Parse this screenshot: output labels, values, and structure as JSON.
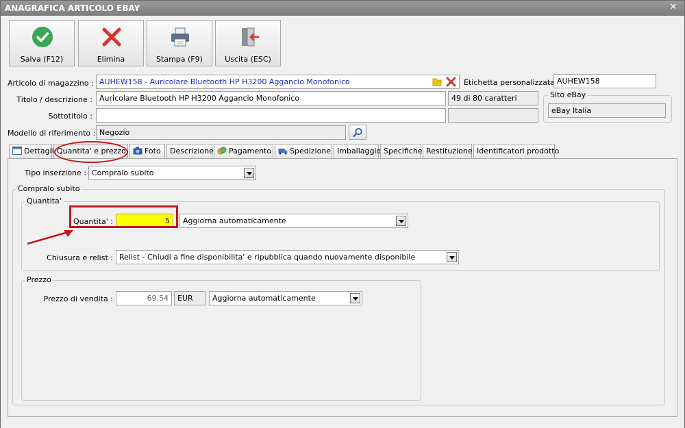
{
  "window": {
    "title": "ANAGRAFICA ARTICOLO EBAY",
    "close_glyph": "✕"
  },
  "toolbar": {
    "save_label": "Salva (F12)",
    "delete_label": "Elimina",
    "print_label": "Stampa (F9)",
    "exit_label": "Uscita (ESC)"
  },
  "form": {
    "articolo_label": "Articolo di magazzino :",
    "articolo_value": "AUHEW158 - Auricolare Bluetooth HP H3200 Aggancio Monofonico",
    "etichetta_label": "Etichetta personalizzata :",
    "etichetta_value": "AUHEW158",
    "titolo_label": "Titolo / descrizione :",
    "titolo_value": "Auricolare Bluetooth HP H3200 Aggancio Monofonico",
    "char_count": "49 di 80 caratteri",
    "sottotitolo_label": "Sottotitolo :",
    "sottotitolo_value": "",
    "modello_label": "Modello di riferimento :",
    "modello_value": "Negozio",
    "sito_group_title": "Sito eBay",
    "sito_value": "eBay Italia"
  },
  "tabs": [
    {
      "label": "Dettagli"
    },
    {
      "label": "Quantita' e prezzo"
    },
    {
      "label": "Foto"
    },
    {
      "label": "Descrizione"
    },
    {
      "label": "Pagamento"
    },
    {
      "label": "Spedizione"
    },
    {
      "label": "Imballaggio"
    },
    {
      "label": "Specifiche"
    },
    {
      "label": "Restituzione"
    },
    {
      "label": "Identificatori prodotto"
    }
  ],
  "panel": {
    "tipo_label": "Tipo inserzione :",
    "tipo_value": "Compralo subito",
    "compralo_group_title": "Compralo subito",
    "quantita_group_title": "Quantita'",
    "quantita_label": "Quantita' :",
    "quantita_value": "5",
    "quantita_mode": "Aggiorna automaticamente",
    "chiusura_label": "Chiusura e relist :",
    "chiusura_value": "Relist - Chiudi a fine disponibilita' e ripubblica quando nuovamente disponibile",
    "prezzo_group_title": "Prezzo",
    "prezzo_label": "Prezzo di vendita :",
    "prezzo_value": "69,54",
    "currency": "EUR",
    "prezzo_mode": "Aggiorna automaticamente"
  },
  "colors": {
    "highlight_fill": "#ffff00",
    "annotation_red": "#c4161c",
    "link_blue": "#1a2fb0",
    "save_green": "#3aa655",
    "delete_red": "#d8342b"
  },
  "icons": [
    "checkmark-icon",
    "x-delete-icon",
    "printer-icon",
    "exit-door-icon",
    "folder-icon",
    "clear-x-icon",
    "search-icon",
    "arrow-annotation-icon"
  ]
}
